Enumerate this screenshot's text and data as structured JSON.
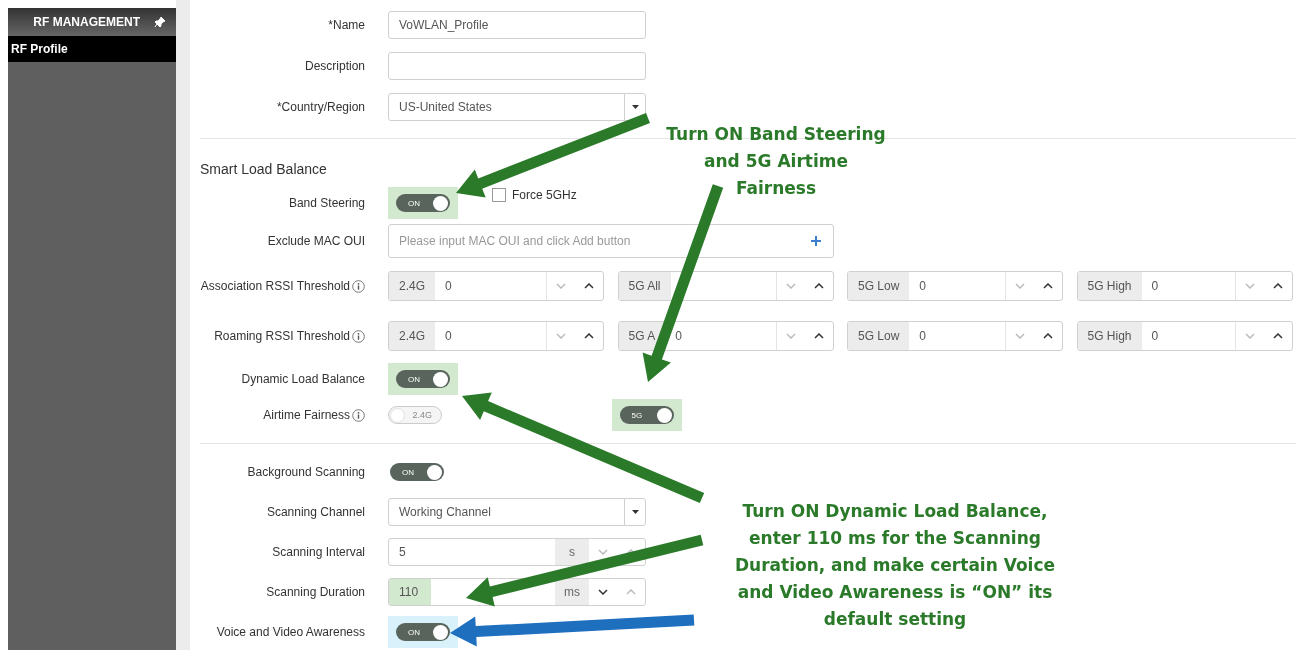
{
  "sidebar": {
    "title": "RF MANAGEMENT",
    "items": [
      {
        "label": "RF Profile",
        "selected": true
      }
    ]
  },
  "sections": [
    {
      "fields": [
        {
          "kind": "text",
          "label": "*Name",
          "value": "VoWLAN_Profile"
        },
        {
          "kind": "text",
          "label": "Description"
        },
        {
          "kind": "select",
          "label": "*Country/Region",
          "value": "US-United States"
        }
      ]
    },
    {
      "heading": "Smart Load Balance",
      "fields": [
        {
          "kind": "toggle",
          "label": "Band Steering",
          "toggles": [
            {
              "text": "ON",
              "on": true,
              "color": "#d3e9cf"
            }
          ],
          "checkbox": {
            "label": "Force 5GHz",
            "checked": false
          }
        },
        {
          "kind": "add",
          "label": "Exclude MAC OUI",
          "placeholder": "Please input MAC OUI and click Add button"
        },
        {
          "kind": "thresholds",
          "label": "Association RSSI Threshold",
          "info": true,
          "groups": [
            {
              "band": "2.4G",
              "value": "0"
            },
            {
              "band": "5G All"
            },
            {
              "band": "5G Low",
              "value": "0"
            },
            {
              "band": "5G High",
              "value": "0"
            }
          ]
        },
        {
          "kind": "thresholds",
          "label": "Roaming RSSI Threshold",
          "info": true,
          "groups": [
            {
              "band": "2.4G",
              "value": "0"
            },
            {
              "band": "5G A",
              "value": "0"
            },
            {
              "band": "5G Low",
              "value": "0"
            },
            {
              "band": "5G High",
              "value": "0"
            }
          ]
        },
        {
          "kind": "toggle",
          "label": "Dynamic Load Balance",
          "toggles": [
            {
              "text": "ON",
              "on": true,
              "color": "#d3e9cf"
            }
          ]
        },
        {
          "kind": "toggle",
          "label": "Airtime Fairness",
          "info": true,
          "toggles": [
            {
              "text": "2.4G",
              "on": false
            },
            {
              "text": "5G",
              "on": true,
              "color": "#d3e9cf"
            }
          ]
        }
      ]
    },
    {
      "fields": [
        {
          "kind": "toggle",
          "label": "Background Scanning",
          "toggles": [
            {
              "text": "ON",
              "on": true
            }
          ]
        },
        {
          "kind": "select",
          "label": "Scanning Channel",
          "value": "Working Channel"
        },
        {
          "kind": "unit",
          "label": "Scanning Interval",
          "value": "5",
          "unit": "s"
        },
        {
          "kind": "unit",
          "label": "Scanning Duration",
          "value": "110",
          "unit": "ms",
          "color": "#d3e9cf"
        },
        {
          "kind": "toggle",
          "label": "Voice and Video Awareness",
          "toggles": [
            {
              "text": "ON",
              "on": true,
              "color": "#d8f1fa"
            }
          ]
        }
      ]
    }
  ],
  "callouts": [
    {
      "lines": [
        "Turn ON Band Steering",
        "and 5G Airtime",
        "Fairness"
      ],
      "arrows": [
        {
          "color": "#2a7a2a"
        },
        {
          "color": "#2a7a2a"
        }
      ]
    },
    {
      "lines": [
        "Turn ON Dynamic Load Balance,",
        "enter 110 ms for the Scanning",
        "Duration, and make certain Voice",
        "and Video Awareness is “ON” its",
        "default setting"
      ],
      "arrows": [
        {
          "color": "#2a7a2a"
        },
        {
          "color": "#2a7a2a"
        },
        {
          "color": "#1f6fbf"
        }
      ]
    }
  ]
}
